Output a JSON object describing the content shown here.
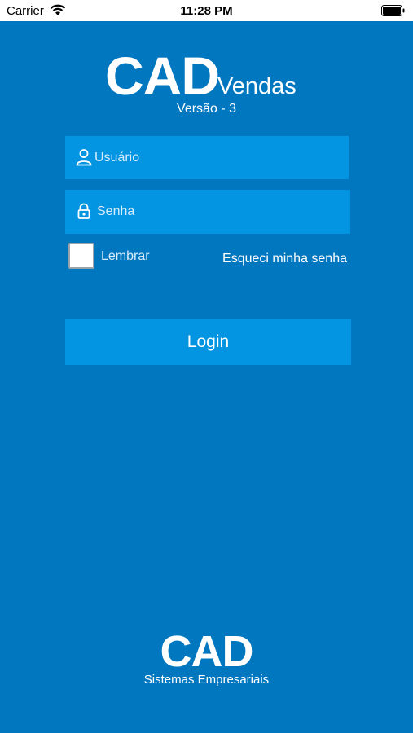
{
  "status_bar": {
    "carrier": "Carrier",
    "time": "11:28 PM"
  },
  "app_logo": {
    "brand": "CAD",
    "product": "Vendas",
    "version": "Versão - 3"
  },
  "login_form": {
    "username": {
      "placeholder": "Usuário",
      "value": "",
      "icon": "user-icon"
    },
    "password": {
      "placeholder": "Senha",
      "value": "",
      "icon": "lock-icon"
    },
    "remember": {
      "label": "Lembrar",
      "checked": false
    },
    "forgot_password": "Esqueci minha senha",
    "login_button": "Login"
  },
  "footer": {
    "company": "CAD",
    "tagline": "Sistemas Empresariais"
  },
  "colors": {
    "background": "#0177c0",
    "field": "#0394e2",
    "text": "#ffffff"
  }
}
